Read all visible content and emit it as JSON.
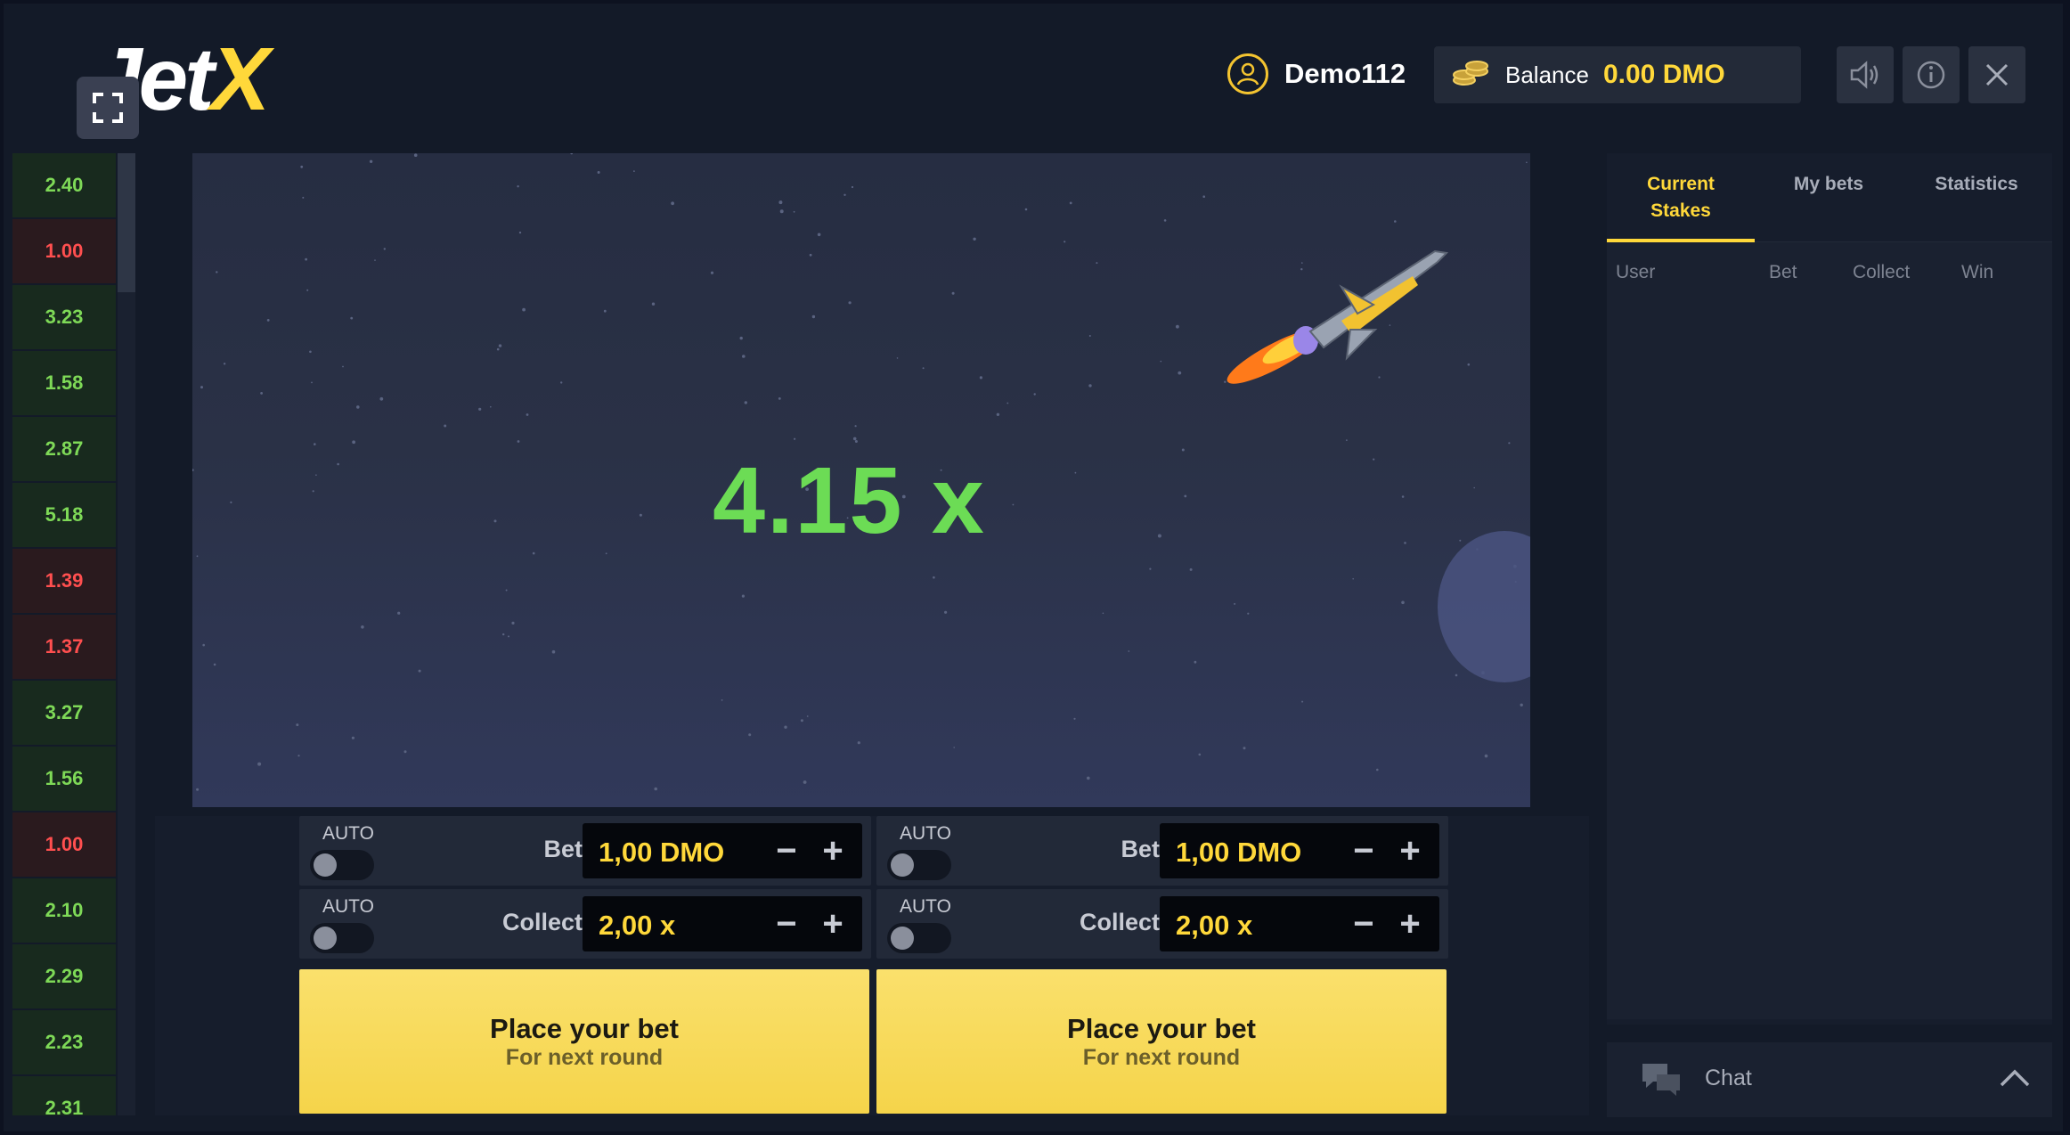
{
  "header": {
    "logo_text_left": "Jet",
    "logo_text_right": "X",
    "username": "Demo112",
    "balance_label": "Balance",
    "balance_value": "0.00 DMO",
    "icons": [
      "fullscreen-icon",
      "user-icon",
      "coins-icon",
      "sound-icon",
      "info-icon",
      "close-icon"
    ]
  },
  "history": [
    {
      "value": "2.40",
      "status": "win"
    },
    {
      "value": "1.00",
      "status": "loss"
    },
    {
      "value": "3.23",
      "status": "win"
    },
    {
      "value": "1.58",
      "status": "win"
    },
    {
      "value": "2.87",
      "status": "win"
    },
    {
      "value": "5.18",
      "status": "win"
    },
    {
      "value": "1.39",
      "status": "loss"
    },
    {
      "value": "1.37",
      "status": "loss"
    },
    {
      "value": "3.27",
      "status": "win"
    },
    {
      "value": "1.56",
      "status": "win"
    },
    {
      "value": "1.00",
      "status": "loss"
    },
    {
      "value": "2.10",
      "status": "win"
    },
    {
      "value": "2.29",
      "status": "win"
    },
    {
      "value": "2.23",
      "status": "win"
    },
    {
      "value": "2.31",
      "status": "win"
    }
  ],
  "game": {
    "multiplier": "4.15 x"
  },
  "panels": [
    {
      "auto_label_1": "AUTO",
      "bet_label": "Bet",
      "bet_value": "1,00 DMO",
      "auto_label_2": "AUTO",
      "collect_label": "Collect",
      "collect_value": "2,00 x",
      "button_main": "Place your bet",
      "button_sub": "For next round"
    },
    {
      "auto_label_1": "AUTO",
      "bet_label": "Bet",
      "bet_value": "1,00 DMO",
      "auto_label_2": "AUTO",
      "collect_label": "Collect",
      "collect_value": "2,00 x",
      "button_main": "Place your bet",
      "button_sub": "For next round"
    }
  ],
  "right_panel": {
    "tabs": [
      {
        "line1": "Current",
        "line2": "Stakes",
        "active": true
      },
      {
        "line1": "My bets",
        "line2": "",
        "active": false
      },
      {
        "line1": "Statistics",
        "line2": "",
        "active": false
      }
    ],
    "columns": [
      "User",
      "Bet",
      "Collect",
      "Win"
    ],
    "chat_label": "Chat"
  },
  "colors": {
    "accent_yellow": "#ffd83a",
    "win_green": "#7ed957",
    "loss_red": "#ff4f4f",
    "multiplier_green": "#6cdc55"
  }
}
